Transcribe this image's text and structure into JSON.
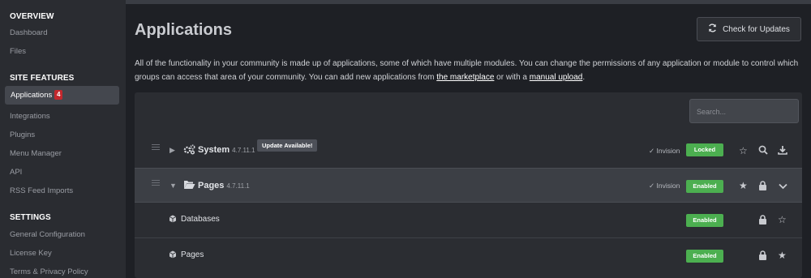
{
  "sidebar": {
    "sections": [
      {
        "title": "OVERVIEW",
        "items": [
          "Dashboard",
          "Files"
        ]
      },
      {
        "title": "SITE FEATURES",
        "items": [
          "Applications",
          "Integrations",
          "Plugins",
          "Menu Manager",
          "API",
          "RSS Feed Imports"
        ]
      },
      {
        "title": "SETTINGS",
        "items": [
          "General Configuration",
          "License Key",
          "Terms & Privacy Policy"
        ]
      }
    ],
    "active_badge": "4"
  },
  "header": {
    "title": "Applications",
    "check_updates_label": "Check for Updates"
  },
  "description": {
    "text_1": "All of the functionality in your community is made up of applications, some of which have multiple modules. You can change the permissions of any application or module to control which groups can access that area of your community. You can add new applications from ",
    "link_marketplace": "the marketplace",
    "text_2": " or with a ",
    "link_manual": "manual upload",
    "text_3": "."
  },
  "search": {
    "placeholder": "Search..."
  },
  "apps": [
    {
      "name": "System",
      "version": "4.7.11.1",
      "update_label": "Update Available!",
      "vendor": "Invision",
      "status": "Locked",
      "icon": "cogs-icon"
    },
    {
      "name": "Pages",
      "version": "4.7.11.1",
      "vendor": "Invision",
      "status": "Enabled",
      "icon": "folder-open-icon",
      "modules": [
        {
          "name": "Databases",
          "status": "Enabled",
          "icon": "cube-icon"
        },
        {
          "name": "Pages",
          "status": "Enabled",
          "icon": "cube-icon"
        }
      ]
    }
  ],
  "colors": {
    "enabled_green": "#4caf50",
    "badge_red": "#c3282d",
    "sidebar_bg": "#2a2c31",
    "main_bg": "#1e2025"
  }
}
